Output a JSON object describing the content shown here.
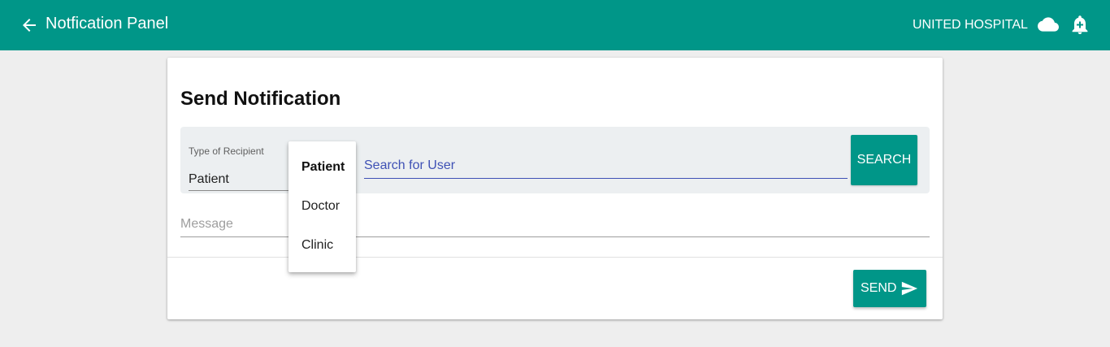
{
  "appbar": {
    "title": "Notfication Panel",
    "hospital": "UNITED HOSPITAL",
    "back_icon": "arrow-left-icon",
    "cloud_icon": "cloud-icon",
    "bell_icon": "bell-plus-icon",
    "color": "#009688"
  },
  "card": {
    "title": "Send Notification",
    "recipient": {
      "label": "Type of Recipient",
      "value": "Patient"
    },
    "search": {
      "placeholder": "Search for User",
      "button_label": "SEARCH"
    },
    "message": {
      "placeholder": "Message"
    },
    "send": {
      "label": "SEND",
      "icon": "send-icon"
    }
  },
  "dropdown": {
    "options": [
      {
        "label": "Patient",
        "selected": true
      },
      {
        "label": "Doctor",
        "selected": false
      },
      {
        "label": "Clinic",
        "selected": false
      }
    ]
  },
  "colors": {
    "accent": "#009688",
    "input_focus": "#3f51b5",
    "background": "#eeeeee"
  }
}
